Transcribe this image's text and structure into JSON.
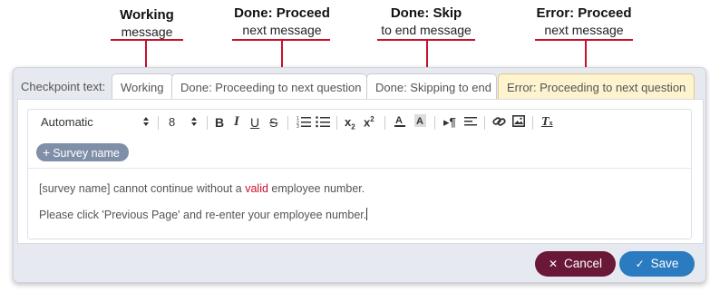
{
  "callouts": [
    {
      "title": "Working",
      "subtitle": "message"
    },
    {
      "title": "Done: Proceed",
      "subtitle": "next message"
    },
    {
      "title": "Done: Skip",
      "subtitle": "to end message"
    },
    {
      "title": "Error: Proceed",
      "subtitle": "next message"
    }
  ],
  "tabs_label": "Checkpoint text:",
  "tabs": [
    {
      "label": "Working"
    },
    {
      "label": "Done: Proceeding to next question"
    },
    {
      "label": "Done: Skipping to end"
    },
    {
      "label": "Error: Proceeding to next question",
      "active": true
    }
  ],
  "toolbar": {
    "font_select": "Automatic",
    "size_select": "8",
    "icons": [
      "bold-icon",
      "italic-icon",
      "underline-icon",
      "strikethrough-icon",
      "ordered-list-icon",
      "bullet-list-icon",
      "subscript-icon",
      "superscript-icon",
      "font-color-icon",
      "highlight-icon",
      "text-direction-icon",
      "align-icon",
      "link-icon",
      "image-icon",
      "clear-format-icon"
    ]
  },
  "chip": {
    "plus": "+",
    "label": "Survey name"
  },
  "content": {
    "line1_before": "[survey name] cannot continue without a ",
    "line1_red": "valid",
    "line1_after": " employee number.",
    "line2": "Please click 'Previous Page' and re-enter your employee number."
  },
  "buttons": {
    "cancel": {
      "icon": "✕",
      "label": "Cancel"
    },
    "save": {
      "icon": "✓",
      "label": "Save"
    }
  },
  "colors": {
    "accent_red": "#c8102e",
    "cancel_bg": "#6a1837",
    "save_bg": "#2a7bbf",
    "active_tab_bg": "#fdf3cf",
    "chip_bg": "#7f8fa8"
  }
}
